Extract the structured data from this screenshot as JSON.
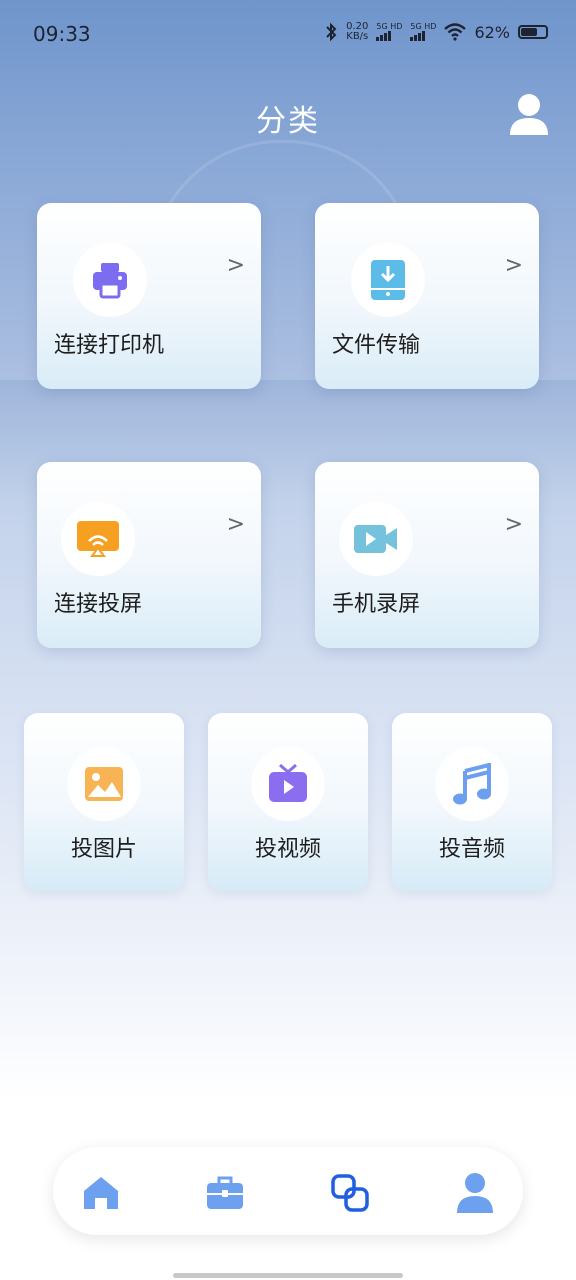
{
  "status_bar": {
    "time": "09:33",
    "speed_value": "0.20",
    "speed_unit": "KB/s",
    "sim1": "5G HD",
    "sim2": "5G HD",
    "battery": "62%"
  },
  "header": {
    "title": "分类"
  },
  "cards": [
    {
      "label": "连接打印机",
      "icon": "printer-icon",
      "chevron": ">"
    },
    {
      "label": "文件传输",
      "icon": "file-transfer-icon",
      "chevron": ">"
    },
    {
      "label": "连接投屏",
      "icon": "cast-screen-icon",
      "chevron": ">"
    },
    {
      "label": "手机录屏",
      "icon": "screen-record-icon",
      "chevron": ">"
    }
  ],
  "small_cards": [
    {
      "label": "投图片",
      "icon": "image-icon"
    },
    {
      "label": "投视频",
      "icon": "tv-video-icon"
    },
    {
      "label": "投音频",
      "icon": "music-icon"
    }
  ],
  "bottom_nav": {
    "items": [
      "home-icon",
      "toolbox-icon",
      "category-icon",
      "profile-icon"
    ],
    "active": "category-icon"
  },
  "colors": {
    "accent": "#1f5fe0",
    "nav_icon": "#6ea0f0",
    "printer": "#7b6cf0",
    "file": "#5bbce8",
    "cast": "#f5a021",
    "record": "#75c2dd",
    "image": "#f8b454",
    "tv": "#8b6df0",
    "music": "#6d9ff0"
  }
}
